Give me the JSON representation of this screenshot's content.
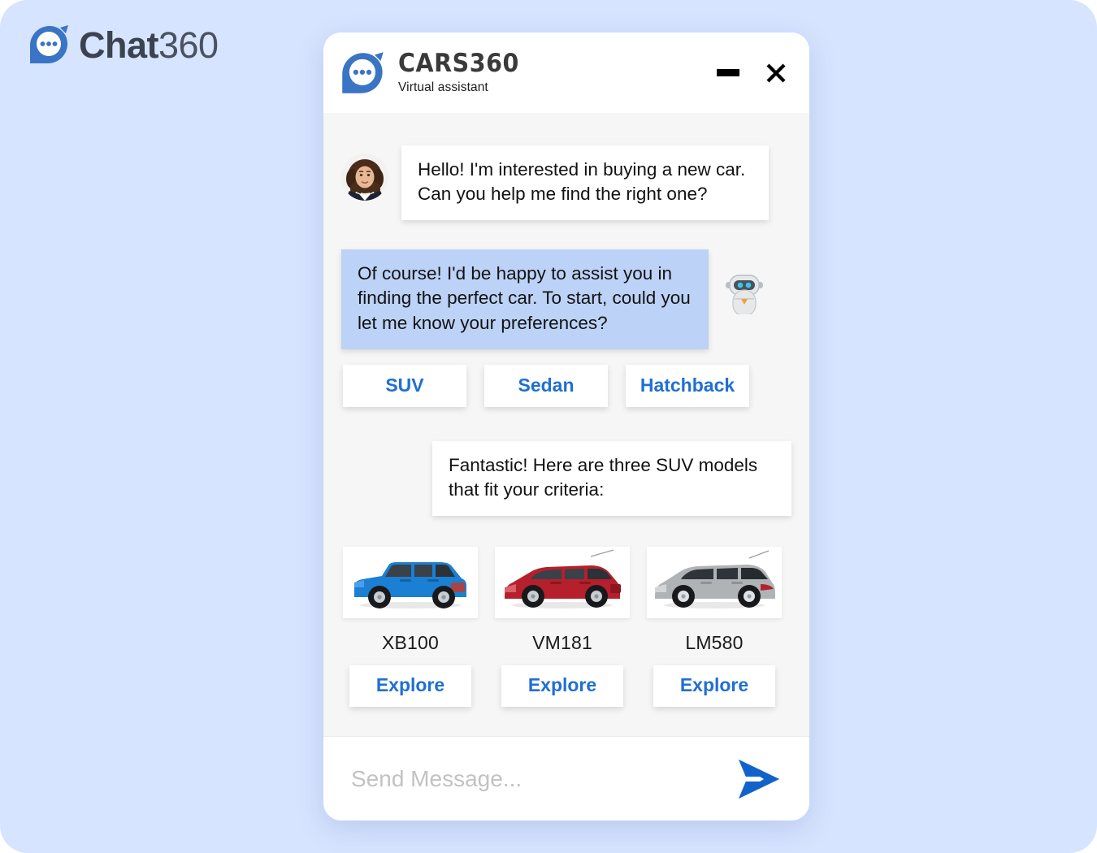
{
  "brand": {
    "logo_icon": "chat-bubble-dots-icon",
    "name_primary": "Chat",
    "name_secondary": "360"
  },
  "widget": {
    "header": {
      "logo_icon": "chat-bubble-dots-icon",
      "title": "CARS360",
      "subtitle": "Virtual assistant",
      "minimize_icon": "minimize-icon",
      "close_icon": "close-icon"
    },
    "messages": [
      {
        "sender": "user",
        "avatar_icon": "user-avatar-photo",
        "text": "Hello! I'm interested in buying a new car. Can you help me find the right one?"
      },
      {
        "sender": "bot",
        "avatar_icon": "robot-avatar-icon",
        "text": "Of course! I'd be happy to assist you in finding the perfect car. To start, could you let me know your preferences?"
      },
      {
        "sender": "bot",
        "text": "Fantastic! Here are three SUV models that fit your criteria:"
      }
    ],
    "quick_replies": [
      {
        "label": "SUV"
      },
      {
        "label": "Sedan"
      },
      {
        "label": "Hatchback"
      }
    ],
    "car_cards": [
      {
        "name": "XB100",
        "button_label": "Explore",
        "image_icon": "blue-suv-image",
        "color": "#1b7fd4"
      },
      {
        "name": "VM181",
        "button_label": "Explore",
        "image_icon": "red-mpv-image",
        "color": "#b5202c"
      },
      {
        "name": "LM580",
        "button_label": "Explore",
        "image_icon": "silver-minivan-image",
        "color": "#b0b3b6"
      }
    ],
    "composer": {
      "placeholder": "Send Message...",
      "value": "",
      "send_icon": "send-paper-plane-icon"
    }
  },
  "colors": {
    "page_background": "#d6e4ff",
    "widget_background": "#f6f6f6",
    "accent_blue": "#1f6fd4",
    "bot_bubble": "#bcd2f7",
    "user_bubble": "#ffffff",
    "logo_blue": "#3a74c4"
  }
}
